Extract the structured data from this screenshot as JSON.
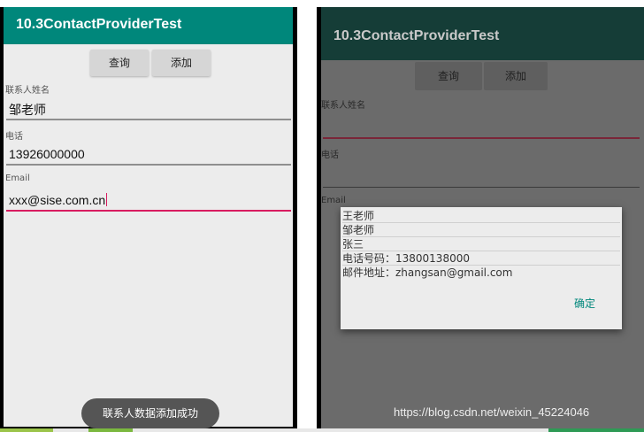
{
  "left": {
    "app_title": "10.3ContactProviderTest",
    "query_label": "查询",
    "add_label": "添加",
    "name_label": "联系人姓名",
    "name_value": "邹老师",
    "phone_label": "电话",
    "phone_value": "13926000000",
    "email_label": "Email",
    "email_value": "xxx@sise.com.cn",
    "toast": "联系人数据添加成功"
  },
  "right": {
    "app_title": "10.3ContactProviderTest",
    "query_label": "查询",
    "add_label": "添加",
    "name_label": "联系人姓名",
    "phone_label": "电话",
    "email_label": "Email",
    "dialog": {
      "items": [
        "王老师",
        "邹老师",
        "张三",
        "电话号码：13800138000",
        "邮件地址：zhangsan@gmail.com"
      ],
      "ok_label": "确定"
    },
    "watermark": "https://blog.csdn.net/weixin_45224046"
  },
  "colors": {
    "app_bar": "#00877b",
    "accent": "#d81b60"
  }
}
